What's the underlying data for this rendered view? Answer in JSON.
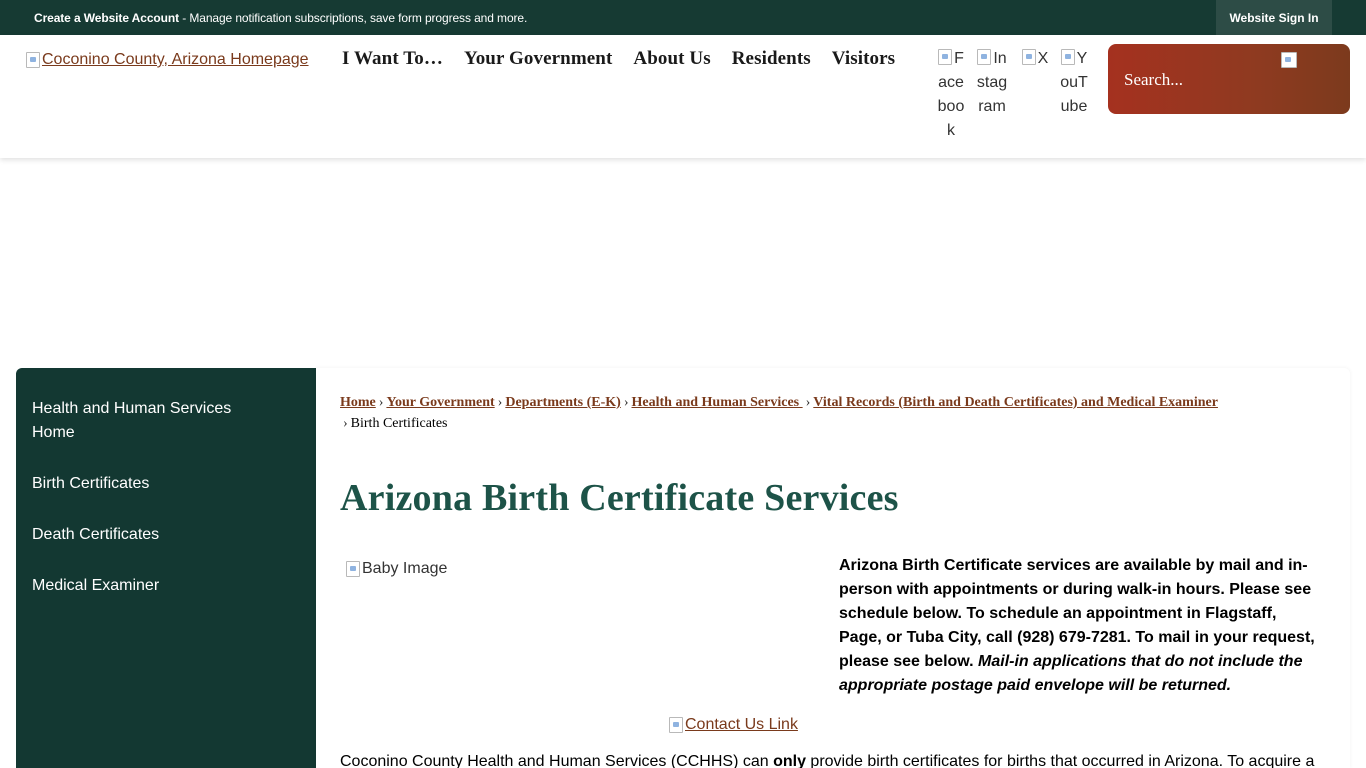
{
  "topbar": {
    "account_link": "Create a Website Account",
    "account_desc": " - Manage notification subscriptions, save form progress and more.",
    "sign_in": "Website Sign In"
  },
  "header": {
    "logo_alt": "Coconino County, Arizona Homepage",
    "nav": [
      "I Want To…",
      "Your Government",
      "About Us",
      "Residents",
      "Visitors"
    ],
    "social": [
      {
        "alt": "Facebook",
        "icon": "facebook-icon"
      },
      {
        "alt": "Instagram",
        "icon": "instagram-icon"
      },
      {
        "alt": "X",
        "icon": "x-icon"
      },
      {
        "alt": "YouTube",
        "icon": "youtube-icon"
      }
    ],
    "search_placeholder": "Search..."
  },
  "sidebar": {
    "items": [
      {
        "label": "Health and Human Services Home"
      },
      {
        "label": "Birth Certificates"
      },
      {
        "label": "Death Certificates"
      },
      {
        "label": "Medical Examiner"
      }
    ]
  },
  "breadcrumb": {
    "links": [
      "Home",
      "Your Government",
      "Departments (E-K)",
      "Health and Human Services ",
      "Vital Records (Birth and Death Certificates) and Medical Examiner"
    ],
    "current": "Birth Certificates",
    "separator": "›"
  },
  "main": {
    "title": "Arizona Birth Certificate Services",
    "image_alt": "Baby Image",
    "intro_bold": "Arizona Birth Certificate services are available by mail and in-person with appointments or during walk-in hours. Please see schedule below. To schedule an appointment in Flagstaff, Page, or Tuba City, call (928) 679-7281. To mail in your request, please see below. ",
    "intro_italic": "Mail-in applications that do not include the appropriate postage paid envelope will be returned.",
    "contact_link": "Contact Us Link",
    "body_pre": "Coconino County Health and Human Services (CCHHS) can ",
    "body_bold": "only",
    "body_post": " provide birth certificates for births that occurred in Arizona. To acquire a"
  },
  "colors": {
    "topbar_bg": "#163a33",
    "sidebar_bg": "#133832",
    "title_color": "#1d5348",
    "link_color": "#7a3a1c",
    "search_bg": "#a5311f"
  }
}
